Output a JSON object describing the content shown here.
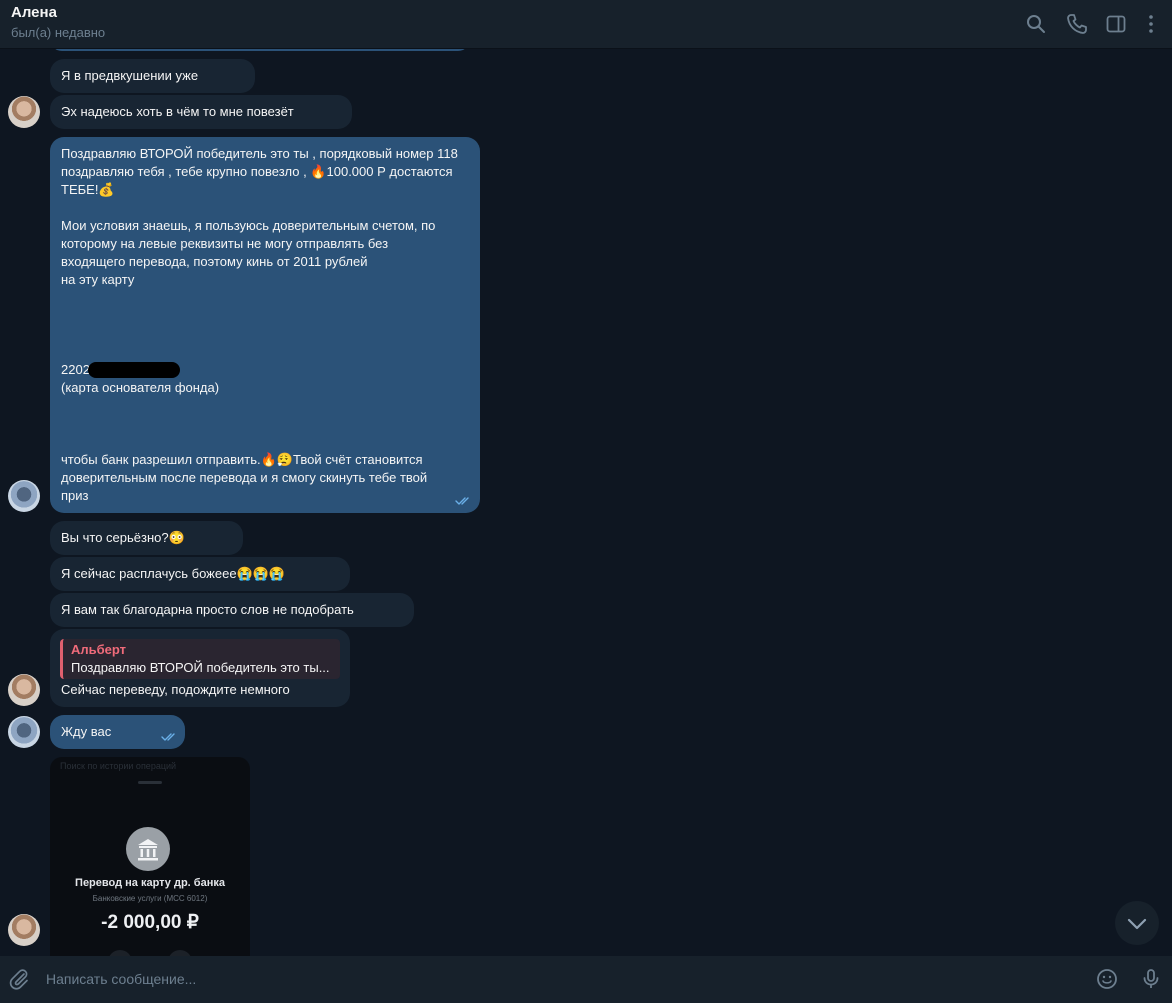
{
  "header": {
    "name": "Алена",
    "status": "был(а) недавно",
    "icons": [
      "search-icon",
      "phone-icon",
      "sidebar-toggle-icon",
      "more-vertical-icon"
    ]
  },
  "messages": [
    {
      "side": "in",
      "text": "Я в предвкушении уже"
    },
    {
      "side": "in",
      "text": "Эх надеюсь хоть в чём то мне повезёт"
    },
    {
      "side": "out",
      "text": "Поздравляю ВТОРОЙ победитель это ты , порядковый номер 118\nпоздравляю тебя , тебе крупно повезло , 🔥100.000 Р достаются\nТЕБЕ!💰\n\nМои условия знаешь, я пользуюсь доверительным счетом, по\nкоторому на левые реквизиты не могу отправлять без\nвходящего перевода, поэтому кинь от 2011 рублей\nна эту карту\n\n\n\n\n2202\n(карта основателя фонда)\n\n\n\nчтобы банк разрешил отправить.🔥😮‍💨Твой счёт становится\nдоверительным после перевода и я смогу скинуть тебе твой\nприз"
    },
    {
      "side": "in",
      "text": "Вы что серьёзно?😳"
    },
    {
      "side": "in",
      "text": "Я сейчас расплачусь божеее😭😭😭"
    },
    {
      "side": "in",
      "text": "Я вам так благодарна просто слов не подобрать"
    },
    {
      "side": "in",
      "reply_name": "Альберт",
      "reply_text": "Поздравляю ВТОРОЙ победитель это ты...",
      "text": "Сейчас переведу, подождите немного"
    },
    {
      "side": "out",
      "text": "Жду вас"
    }
  ],
  "screenshot": {
    "search": "Поиск по истории операций",
    "title": "Перевод на карту др. банка",
    "subtitle": "Банковские услуги (MCC 6012)",
    "amount": "-2 000,00 ₽"
  },
  "composer": {
    "placeholder": "Написать сообщение..."
  },
  "colors": {
    "background": "#0e1621",
    "incoming_bubble": "#182533",
    "outgoing_bubble": "#2b5278",
    "reply_accent": "#e0606e"
  }
}
